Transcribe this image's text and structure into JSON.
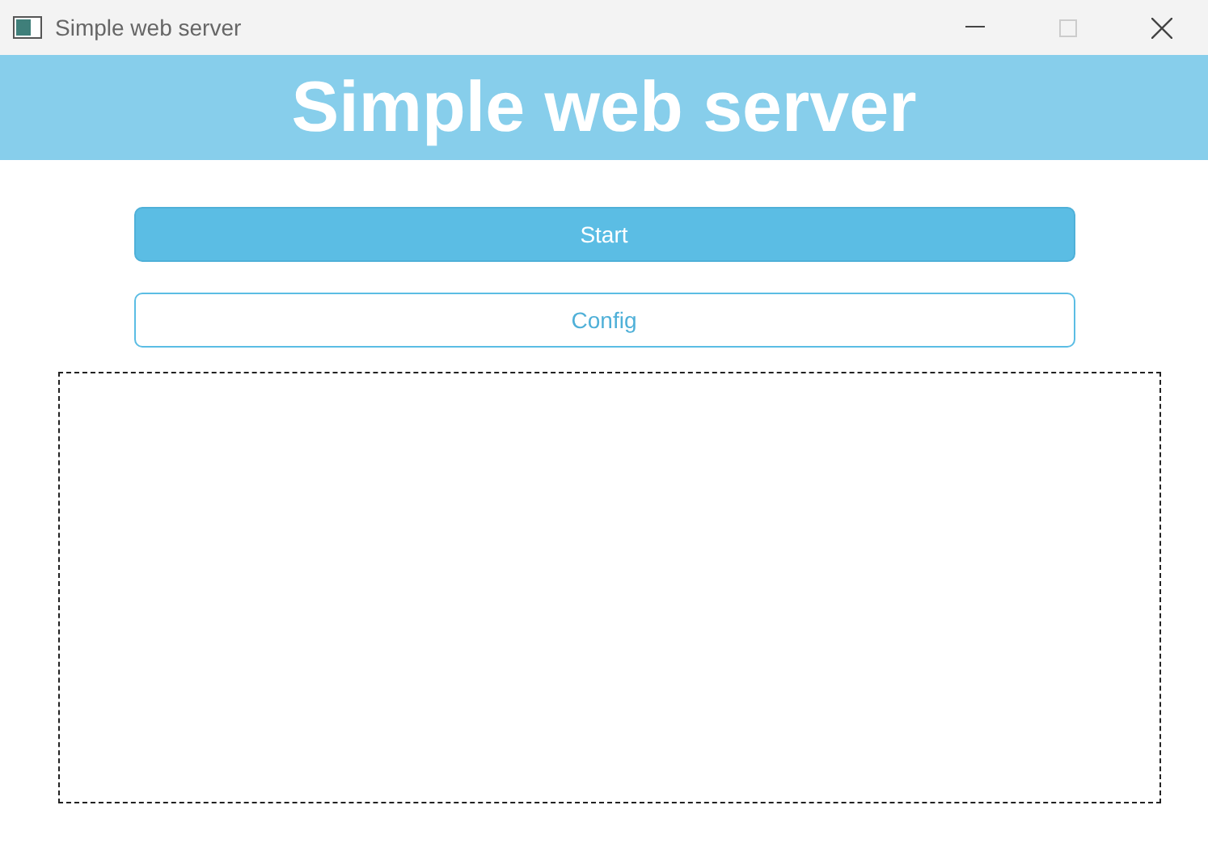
{
  "window": {
    "title": "Simple web server"
  },
  "header": {
    "title": "Simple web server"
  },
  "buttons": [
    {
      "label": "Start",
      "kind": "primary"
    },
    {
      "label": "Config",
      "kind": "outline"
    }
  ]
}
